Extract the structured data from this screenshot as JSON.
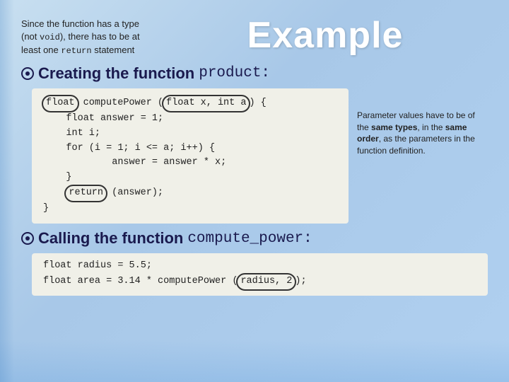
{
  "title": "Example",
  "description": {
    "text": "Since the function has a type (not ",
    "keyword1": "void",
    "text2": "), there has to be at least one ",
    "keyword2": "return",
    "text3": " statement"
  },
  "section1": {
    "prefix": "Creating the function ",
    "mono": "product:"
  },
  "code1": {
    "lines": [
      {
        "id": "l1",
        "text": "float computePower (float x, int a) {"
      },
      {
        "id": "l2",
        "text": "    float answer = 1;"
      },
      {
        "id": "l3",
        "text": "    int i;"
      },
      {
        "id": "l4",
        "text": "    for (i = 1; i <= a; i++) {"
      },
      {
        "id": "l5",
        "text": "            answer = answer * x;"
      },
      {
        "id": "l6",
        "text": "    }"
      },
      {
        "id": "l7",
        "text": "    return (answer);"
      },
      {
        "id": "l8",
        "text": "}"
      }
    ]
  },
  "note": {
    "text": "Parameter values have to be of the ",
    "bold1": "same types",
    "text2": ", in the ",
    "bold2": "same order",
    "text3": ", as the parameters in the function definition."
  },
  "section2": {
    "prefix": "Calling the function ",
    "mono": "compute_power:"
  },
  "code2": {
    "lines": [
      {
        "id": "c1",
        "text": "float radius = 5.5;"
      },
      {
        "id": "c2",
        "text": "float area = 3.14 * computePower (radius, 2);"
      }
    ]
  }
}
